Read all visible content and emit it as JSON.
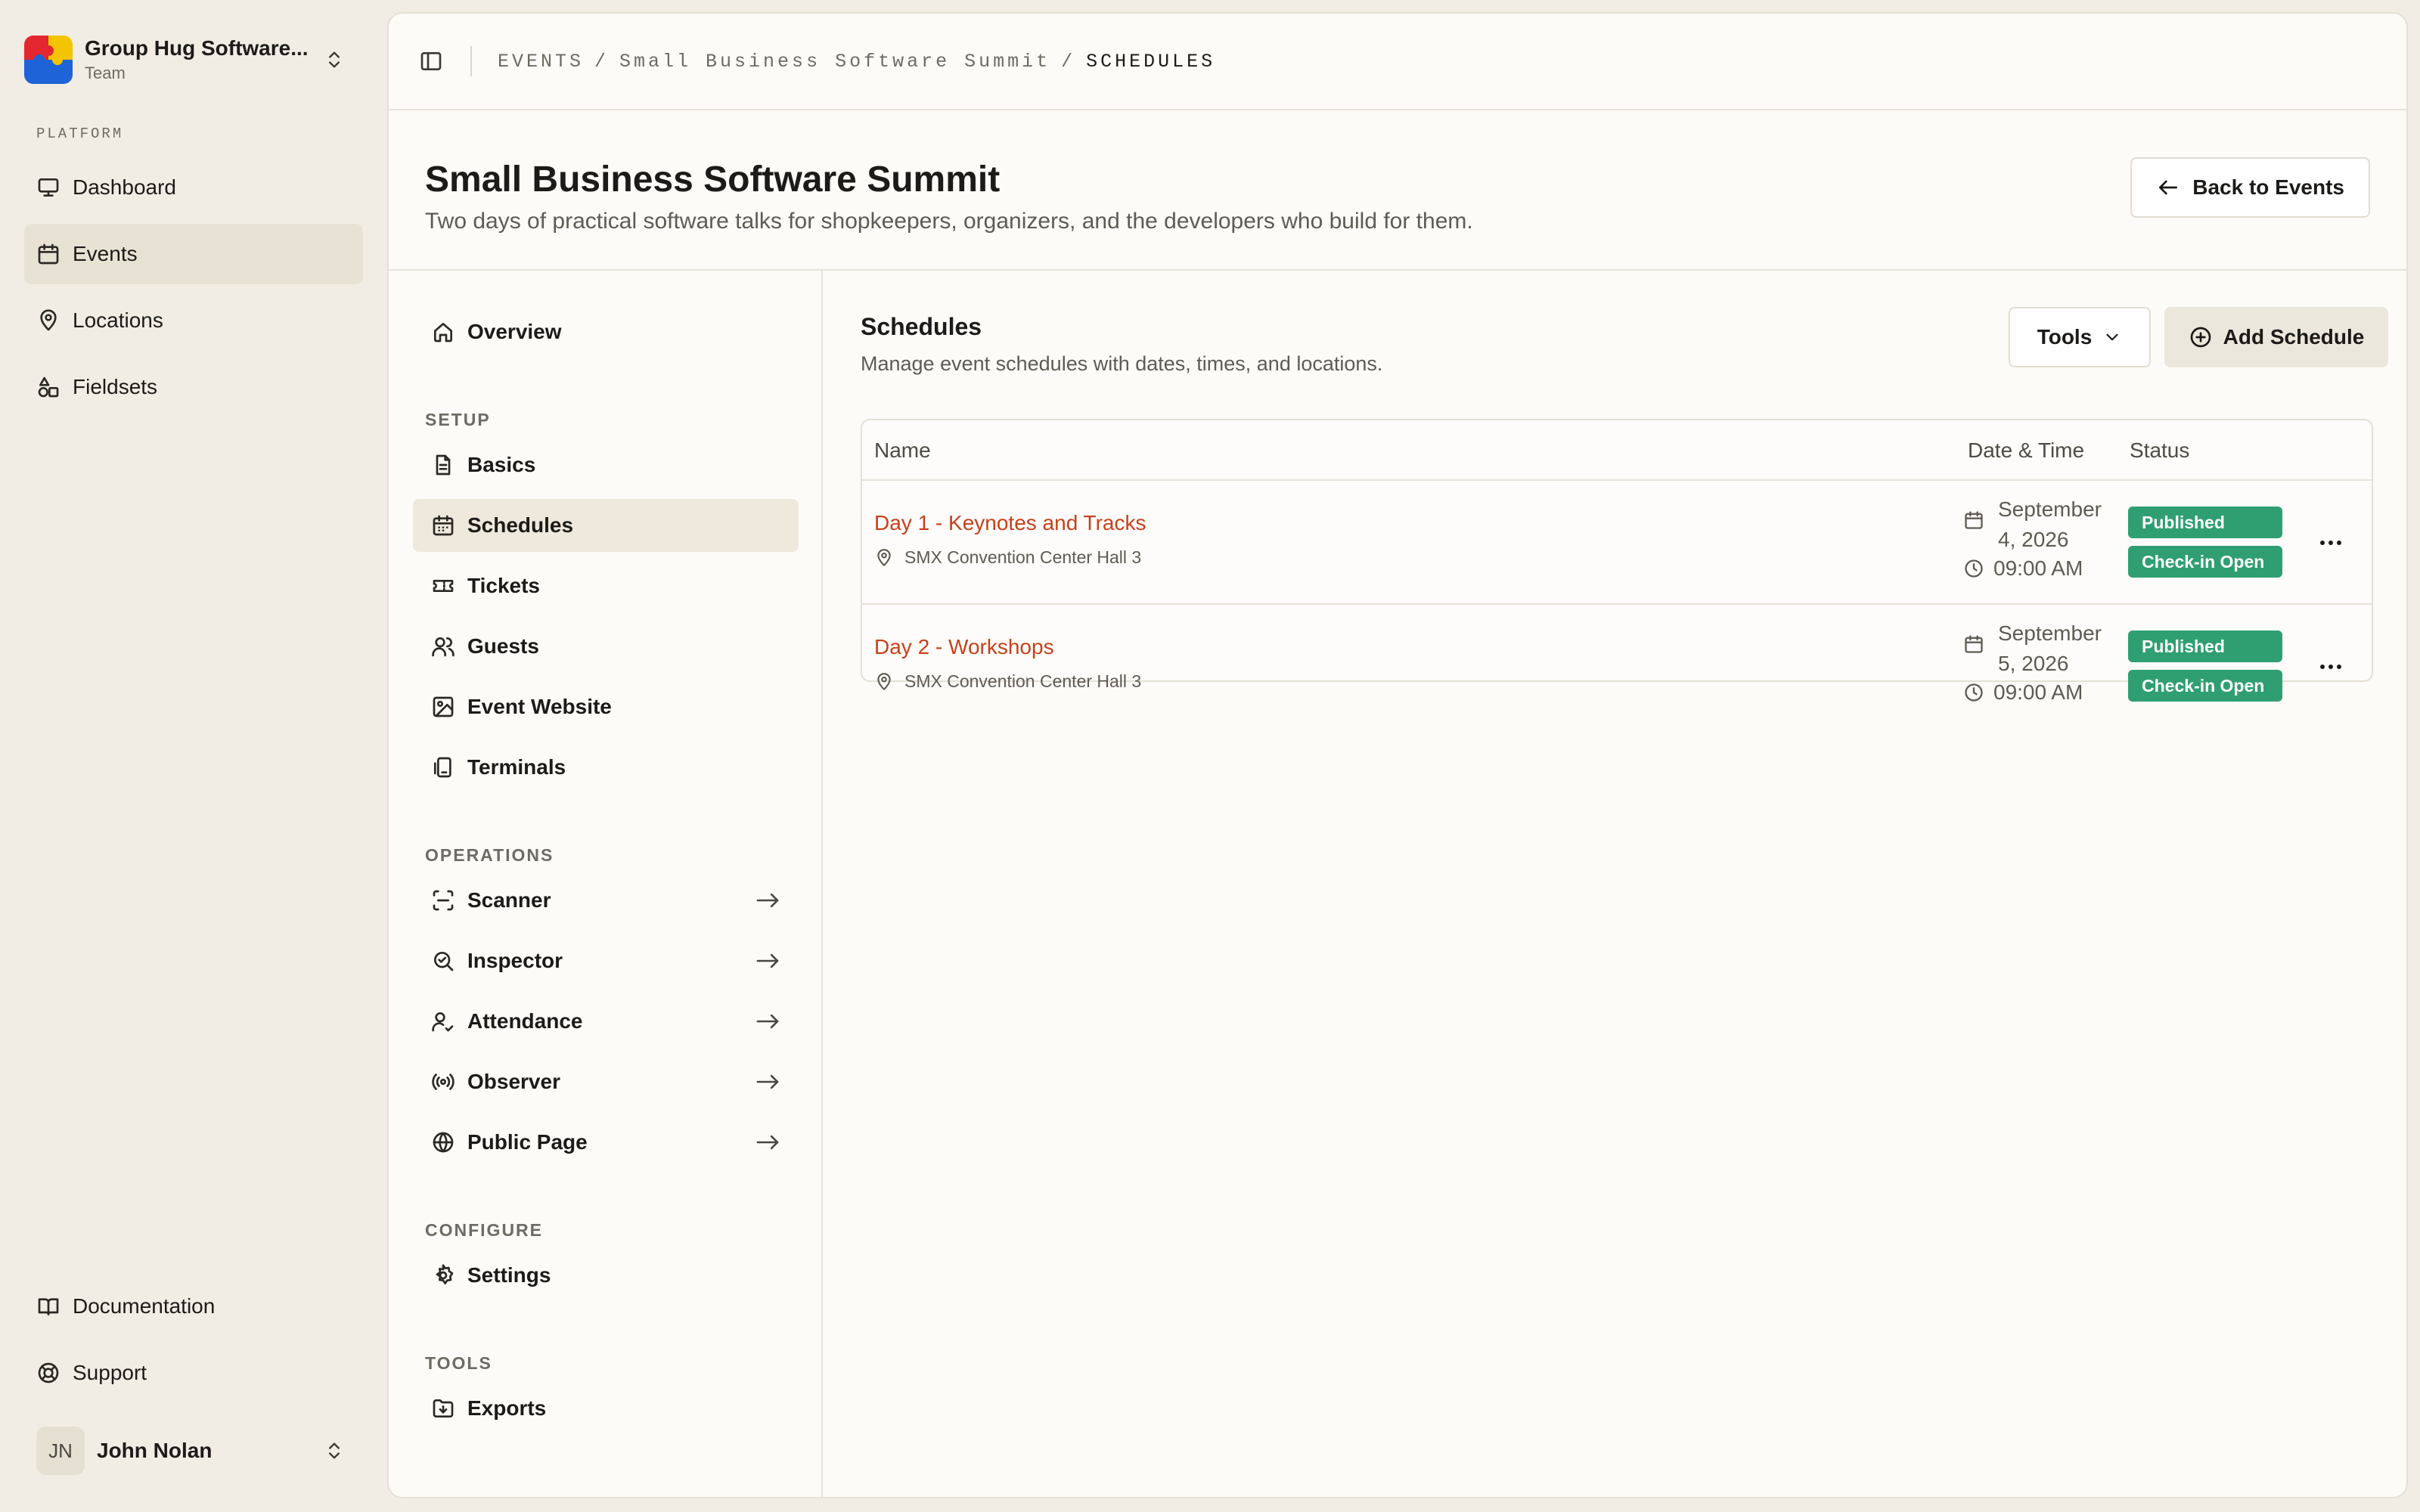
{
  "team": {
    "name": "Group Hug Software...",
    "subtitle": "Team",
    "logo_colors": [
      "#e3262f",
      "#f5c400",
      "#1e63d8"
    ]
  },
  "sidebar": {
    "group_label": "PLATFORM",
    "items": [
      {
        "label": "Dashboard",
        "icon": "monitor-icon"
      },
      {
        "label": "Events",
        "icon": "calendar-icon",
        "active": true
      },
      {
        "label": "Locations",
        "icon": "map-pin-icon"
      },
      {
        "label": "Fieldsets",
        "icon": "shapes-icon"
      }
    ],
    "footer_items": [
      {
        "label": "Documentation",
        "icon": "book-icon"
      },
      {
        "label": "Support",
        "icon": "lifebuoy-icon"
      }
    ]
  },
  "user": {
    "initials": "JN",
    "name": "John Nolan"
  },
  "breadcrumb": {
    "items": [
      "EVENTS",
      "Small Business Software Summit"
    ],
    "current": "SCHEDULES",
    "separator": "/"
  },
  "page": {
    "title": "Small Business Software Summit",
    "description": "Two days of practical software talks for shopkeepers, organizers, and the developers who build for them.",
    "back_label": "Back to Events"
  },
  "subnav": {
    "overview": "Overview",
    "setup_label": "SETUP",
    "setup": [
      "Basics",
      "Schedules",
      "Tickets",
      "Guests",
      "Event Website",
      "Terminals"
    ],
    "active": "Schedules",
    "operations_label": "OPERATIONS",
    "operations": [
      "Scanner",
      "Inspector",
      "Attendance",
      "Observer",
      "Public Page"
    ],
    "configure_label": "CONFIGURE",
    "configure": [
      "Settings"
    ],
    "tools_label": "TOOLS",
    "tools": [
      "Exports"
    ]
  },
  "schedules": {
    "title": "Schedules",
    "description": "Manage event schedules with dates, times, and locations.",
    "tools_label": "Tools",
    "add_label": "Add Schedule",
    "columns": [
      "Name",
      "Date & Time",
      "Status"
    ],
    "rows": [
      {
        "name": "Day 1 - Keynotes and Tracks",
        "location": "SMX Convention Center Hall 3",
        "date": "September 4, 2026",
        "time": "09:00 AM",
        "statuses": [
          "Published",
          "Check-in Open"
        ]
      },
      {
        "name": "Day 2 - Workshops",
        "location": "SMX Convention Center Hall 3",
        "date": "September 5, 2026",
        "time": "09:00 AM",
        "statuses": [
          "Published",
          "Check-in Open"
        ]
      }
    ]
  },
  "colors": {
    "accent_link": "#c8401a",
    "status_green": "#2f9f72",
    "app_background": "#f1ede4"
  }
}
